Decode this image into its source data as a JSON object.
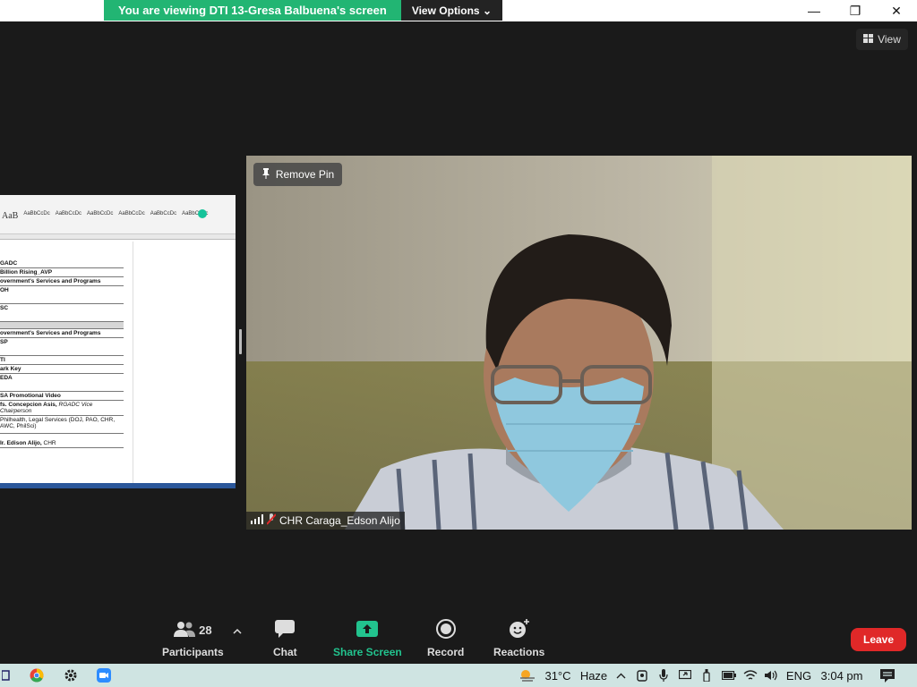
{
  "banner": {
    "message": "You are viewing DTI 13-Gresa Balbuena's screen",
    "view_options": "View Options ⌄"
  },
  "window": {
    "minimize": "—",
    "maximize": "❐",
    "close": "✕"
  },
  "view_button": "View",
  "shared_doc": {
    "ribbon_styles": [
      "AaB",
      "AaBbCcDc",
      "AaBbCcDc",
      "AaBbCcDc",
      "AaBbCcDc",
      "AaBbCcDc",
      "AaBbCcDc"
    ],
    "rows": [
      {
        "text": "GADC",
        "style": "bold"
      },
      {
        "text": "Billion Rising_AVP",
        "style": "bold"
      },
      {
        "text": "overnment's Services and Programs",
        "style": "bold"
      },
      {
        "text": "OH",
        "style": "tall"
      },
      {
        "text": "SC",
        "style": "tall"
      },
      {
        "text": "",
        "style": "gray"
      },
      {
        "text": "overnment's Services and Programs",
        "style": "bold"
      },
      {
        "text": "SP",
        "style": "tall"
      },
      {
        "text": "TI",
        "style": "bold"
      },
      {
        "text": "ark Key",
        "style": "bold"
      },
      {
        "text": "EDA",
        "style": "tall"
      },
      {
        "text": "SA Promotional Video",
        "style": "bold"
      }
    ],
    "asis_name": "fs. Concepcion Asis,",
    "asis_role": "RGADC Vice Chairperson",
    "philhealth_line1": "Philhealth, Legal Services (DOJ, PAO, CHR,",
    "philhealth_line2": "AWC, PhilSci)",
    "alijo_name": "Ir. Edison Alijo,",
    "alijo_org": "CHR"
  },
  "video": {
    "remove_pin_label": "Remove Pin",
    "participant_name": "CHR Caraga_Edson Alijo"
  },
  "toolbar": {
    "participants_count": "28",
    "participants_label": "Participants",
    "chat_label": "Chat",
    "share_label": "Share Screen",
    "record_label": "Record",
    "reactions_label": "Reactions",
    "leave_label": "Leave"
  },
  "taskbar": {
    "temperature": "31°C",
    "weather": "Haze",
    "language": "ENG",
    "time": "3:04 pm"
  },
  "colors": {
    "share_green": "#22b573",
    "leave_red": "#e02828",
    "taskbar_bg": "#cfe4e2"
  }
}
